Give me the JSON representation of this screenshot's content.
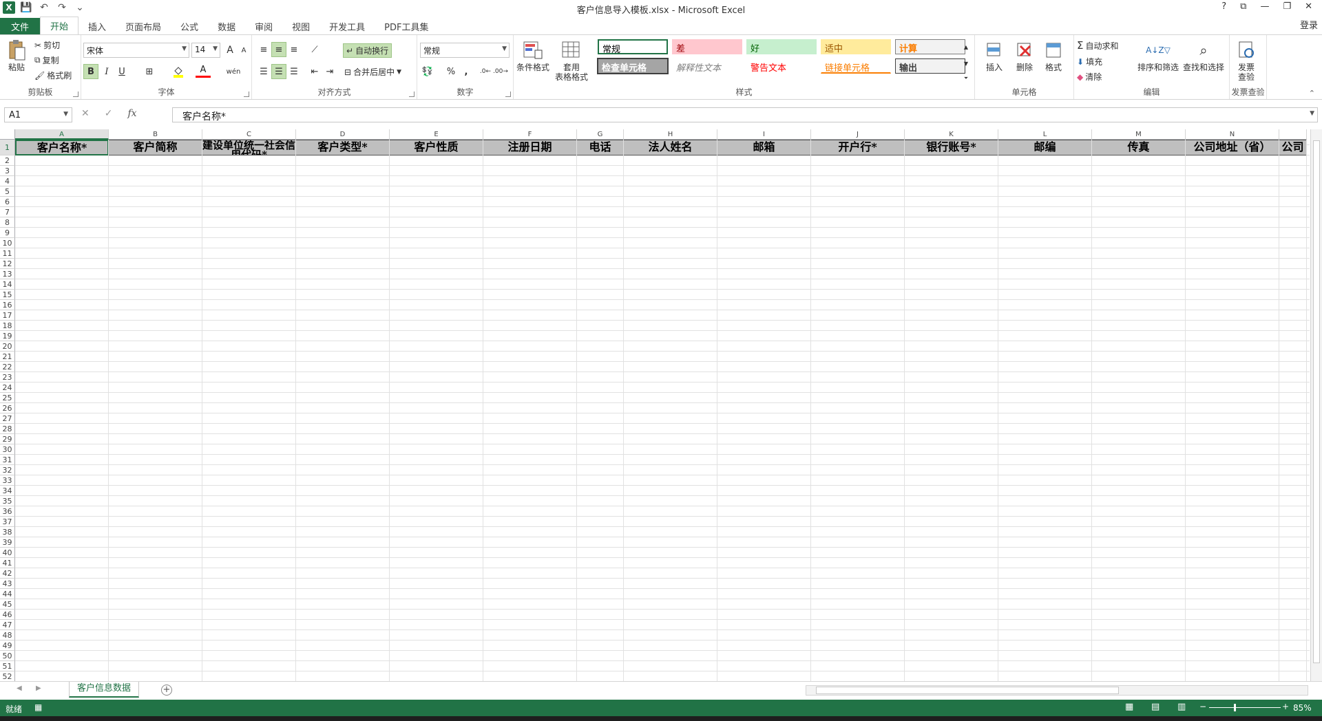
{
  "window": {
    "title": "客户信息导入模板.xlsx - Microsoft Excel",
    "controls": [
      "?",
      "⧉",
      "—",
      "❐",
      "✕"
    ],
    "login": "登录"
  },
  "qat": {
    "logo": "X",
    "save": "💾",
    "undo": "↶",
    "redo": "↷",
    "custom": "⌄"
  },
  "tabs": [
    "文件",
    "开始",
    "插入",
    "页面布局",
    "公式",
    "数据",
    "审阅",
    "视图",
    "开发工具",
    "PDF工具集"
  ],
  "ribbon": {
    "clipboard": {
      "label": "剪贴板",
      "paste": "粘贴",
      "cut": "剪切",
      "copy": "复制",
      "painter": "格式刷"
    },
    "font": {
      "label": "字体",
      "name": "宋体",
      "size": "14",
      "bold": "B",
      "italic": "I",
      "underline": "U",
      "grow": "A",
      "shrink": "A",
      "fontcolor": "A",
      "wen": "wén"
    },
    "align": {
      "label": "对齐方式",
      "wrap": "自动换行",
      "merge": "合并后居中"
    },
    "number": {
      "label": "数字",
      "format": "常规",
      "percent": "%",
      "comma": ","
    },
    "styles": {
      "label": "样式",
      "cond": "条件格式",
      "table1": "套用",
      "table2": "表格格式",
      "cells": [
        {
          "name": "常规",
          "bg": "#ffffff",
          "color": "#000000",
          "border": "#217346"
        },
        {
          "name": "差",
          "bg": "#ffc7ce",
          "color": "#9c0006",
          "border": "#ffc7ce"
        },
        {
          "name": "好",
          "bg": "#c6efce",
          "color": "#006100",
          "border": "#c6efce"
        },
        {
          "name": "适中",
          "bg": "#ffeb9c",
          "color": "#9c5700",
          "border": "#ffeb9c"
        },
        {
          "name": "计算",
          "bg": "#f2f2f2",
          "color": "#fa7d00",
          "border": "#7f7f7f"
        },
        {
          "name": "检查单元格",
          "bg": "#a5a5a5",
          "color": "#ffffff",
          "border": "#3f3f3f"
        },
        {
          "name": "解释性文本",
          "bg": "#ffffff",
          "color": "#7f7f7f",
          "border": "#ffffff"
        },
        {
          "name": "警告文本",
          "bg": "#ffffff",
          "color": "#ff0000",
          "border": "#ffffff"
        },
        {
          "name": "链接单元格",
          "bg": "#ffffff",
          "color": "#fa7d00",
          "border": "#ffffff"
        },
        {
          "name": "输出",
          "bg": "#f2f2f2",
          "color": "#3f3f3f",
          "border": "#3f3f3f"
        }
      ]
    },
    "cells": {
      "label": "单元格",
      "insert": "插入",
      "delete": "删除",
      "format": "格式"
    },
    "editing": {
      "label": "编辑",
      "autosum": "自动求和",
      "fill": "填充",
      "clear": "清除",
      "sort": "排序和筛选",
      "find": "查找和选择"
    },
    "invoice": {
      "label": "发票查验",
      "btn1": "发票",
      "btn2": "查验"
    }
  },
  "formula_bar": {
    "namebox": "A1",
    "cancel": "✕",
    "enter": "✓",
    "fx": "fx",
    "content": "客户名称*"
  },
  "sheet": {
    "columns": [
      "A",
      "B",
      "C",
      "D",
      "E",
      "F",
      "G",
      "H",
      "I",
      "J",
      "K",
      "L",
      "M",
      "N",
      ""
    ],
    "header_row": [
      "客户名称*",
      "客户简称",
      "建设单位统一社会信用代码*",
      "客户类型*",
      "客户性质",
      "注册日期",
      "电话",
      "法人姓名",
      "邮箱",
      "开户行*",
      "银行账号*",
      "邮编",
      "传真",
      "公司地址（省）",
      "公司"
    ],
    "rows": [
      "1",
      "2",
      "3",
      "4",
      "5",
      "6",
      "7",
      "8",
      "9",
      "10",
      "11",
      "12",
      "13",
      "14",
      "15",
      "16",
      "17",
      "18",
      "19",
      "20",
      "21",
      "22",
      "23",
      "24",
      "25",
      "26",
      "27",
      "28",
      "29",
      "30",
      "31",
      "32",
      "33",
      "34",
      "35",
      "36",
      "37",
      "38",
      "39",
      "40",
      "41",
      "42",
      "43",
      "44",
      "45",
      "46",
      "47",
      "48",
      "49",
      "50",
      "51",
      "52"
    ]
  },
  "sheet_tabs": {
    "active": "客户信息数据",
    "add": "+"
  },
  "status": {
    "ready": "就绪",
    "zoom": "85%",
    "minus": "−",
    "plus": "+"
  },
  "colors": {
    "accent": "#217346",
    "header_fill": "#bfbfbf"
  }
}
